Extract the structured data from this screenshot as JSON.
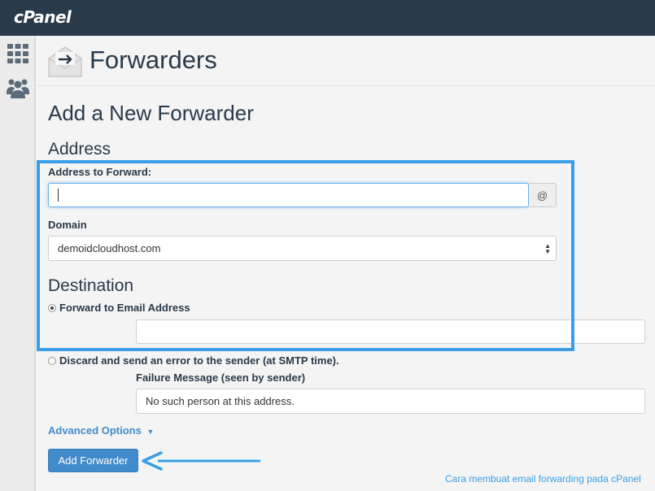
{
  "app": {
    "brand": "cPanel"
  },
  "header": {
    "title": "Forwarders",
    "icon": "envelope-forward-icon"
  },
  "sidebar": {
    "icons": [
      "grid-icon",
      "users-icon"
    ]
  },
  "form": {
    "heading": "Add a New Forwarder",
    "address_section": "Address",
    "address_label": "Address to Forward:",
    "address_value": "",
    "at_symbol": "@",
    "domain_label": "Domain",
    "domain_value": "demoidcloudhost.com",
    "destination_section": "Destination",
    "option_forward_label": "Forward to Email Address",
    "forward_email_value": "",
    "option_discard_label": "Discard and send an error to the sender (at SMTP time).",
    "failure_label": "Failure Message (seen by sender)",
    "failure_value": "No such person at this address.",
    "advanced_label": "Advanced Options",
    "submit_label": "Add Forwarder"
  },
  "annotation": {
    "caption": "Cara membuat email forwarding pada cPanel",
    "color": "#3a9fe8"
  },
  "colors": {
    "topbar": "#293a4a",
    "accent": "#428bca"
  }
}
